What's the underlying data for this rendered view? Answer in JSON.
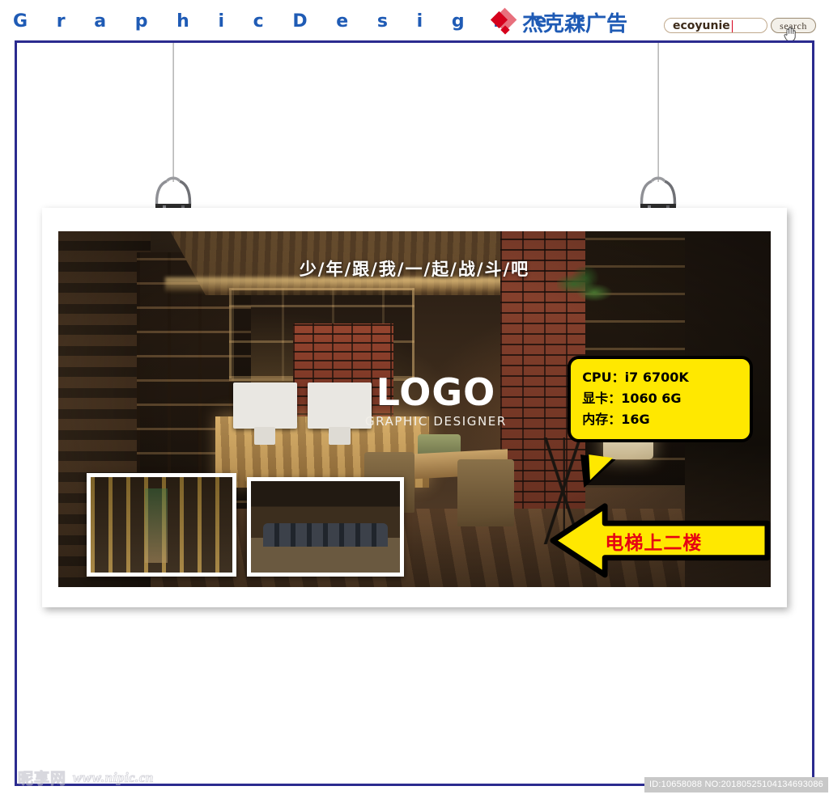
{
  "header": {
    "site_title": "G r a p h i c    D e s i g n e r",
    "brand_name": "杰克森广告",
    "brand_icon": "red-diamond-logo",
    "search": {
      "value": "ecoyunie",
      "placeholder": "",
      "button_label": "search",
      "cursor_icon": "hand-pointer-icon"
    }
  },
  "poster": {
    "headline": "少/年/跟/我/一/起/战/斗/吧",
    "logo": {
      "main": "LOGO",
      "sub": "GRAPHIC DESIGNER"
    },
    "spec_bubble": {
      "lines": [
        "CPU：i7 6700K",
        "显卡：1060  6G",
        "内存：16G"
      ]
    },
    "arrow": {
      "label": "电梯上二楼",
      "direction": "left",
      "fill_color": "#ffe800",
      "text_color": "#e60012"
    },
    "thumbnails": [
      {
        "name": "interior-corridor-shelves"
      },
      {
        "name": "interior-bar-seating"
      }
    ],
    "clips": [
      {
        "name": "binder-clip-left"
      },
      {
        "name": "binder-clip-right"
      }
    ]
  },
  "footer": {
    "watermark_mark": "昵享网",
    "watermark_url": "www.nipic.cn",
    "id_badge": "ID:10658088 NO:20180525104134693086"
  },
  "colors": {
    "brand_blue": "#1f5bb5",
    "brand_red": "#d6001c",
    "frame_blue": "#2b2b8f",
    "accent_yellow": "#ffe800"
  }
}
